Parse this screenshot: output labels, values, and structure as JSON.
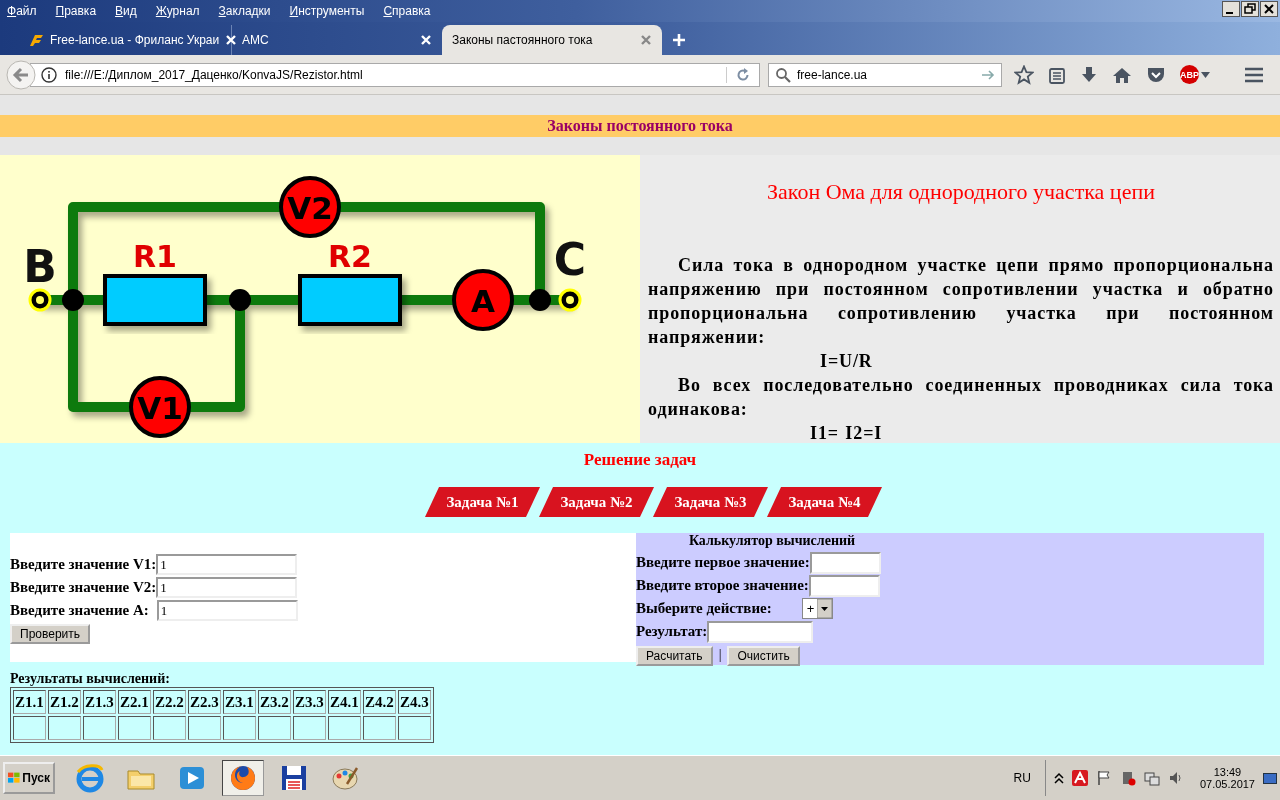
{
  "browser": {
    "menu": [
      "Файл",
      "Правка",
      "Вид",
      "Журнал",
      "Закладки",
      "Инструменты",
      "Справка"
    ],
    "tabs": [
      {
        "title": "Free-lance.ua - Фриланс Украи",
        "selected": false,
        "kind": "logo"
      },
      {
        "title": "AMC",
        "selected": false,
        "kind": "plain"
      },
      {
        "title": "Законы пастоянного тока",
        "selected": true,
        "kind": "plain"
      }
    ],
    "address": "file:///E:/Диплом_2017_Даценко/KonvaJS/Rezistor.html",
    "search": "free-lance.ua",
    "adblock_badge": "ABP"
  },
  "page": {
    "header": "Законы постоянного тока",
    "circuit": {
      "node_labels": [
        "B",
        "C"
      ],
      "resistors": [
        "R1",
        "R2"
      ],
      "meters": [
        "V2",
        "A",
        "V1"
      ]
    },
    "law": {
      "title": "Закон Ома для однородного участка цепи",
      "blocks": [
        {
          "kind": "paragraph",
          "text": "Сила тока в однородном участке цепи прямо пропорциональна напряжению при постоянном сопротивлении участка и обратно пропорциональна сопротивлению участка при постоянном напряжении:"
        },
        {
          "kind": "formula",
          "text": "I=U/R"
        },
        {
          "kind": "paragraph",
          "text": "Во всех последовательно соединенных проводниках сила тока одинакова:"
        },
        {
          "kind": "formula",
          "text": "I1= I2=I"
        }
      ]
    },
    "tasks": {
      "heading": "Решение задач",
      "tabs": [
        "Задача №1",
        "Задача №2",
        "Задача №3",
        "Задача №4"
      ]
    },
    "form": {
      "fields": [
        {
          "label": "Введите значение V1:",
          "value": "1"
        },
        {
          "label": "Введите значение V2:",
          "value": "1"
        },
        {
          "label": "Введите значение A:",
          "value": "1"
        }
      ],
      "button": "Проверить"
    },
    "calculator": {
      "title": "Калькулятор вычислений",
      "fields": [
        {
          "label": "Введите первое значение:"
        },
        {
          "label": "Введите второе значение:"
        }
      ],
      "operation": {
        "label": "Выберите действие:",
        "value": "+"
      },
      "result_label": "Результат:",
      "buttons": [
        "Расчитать",
        "Очистить"
      ],
      "separator": "|"
    },
    "results": {
      "label": "Результаты вычислений:",
      "columns": [
        "Z1.1",
        "Z1.2",
        "Z1.3",
        "Z2.1",
        "Z2.2",
        "Z2.3",
        "Z3.1",
        "Z3.2",
        "Z3.3",
        "Z4.1",
        "Z4.2",
        "Z4.3"
      ]
    }
  },
  "taskbar": {
    "start": "Пуск",
    "language": "RU",
    "time": "13:49",
    "date": "07.05.2017"
  }
}
